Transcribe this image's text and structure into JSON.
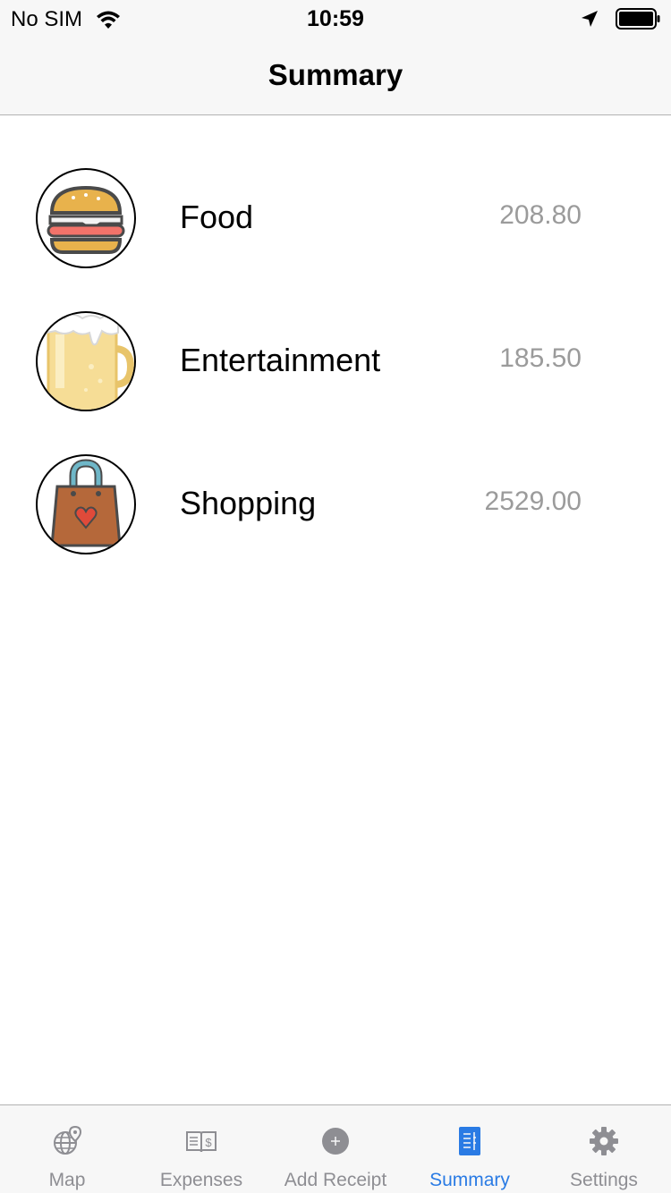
{
  "status_bar": {
    "carrier": "No SIM",
    "time": "10:59"
  },
  "nav": {
    "title": "Summary"
  },
  "categories": [
    {
      "icon": "burger-icon",
      "label": "Food",
      "amount": "208.80"
    },
    {
      "icon": "beer-mug-icon",
      "label": "Entertainment",
      "amount": "185.50"
    },
    {
      "icon": "shopping-bag-icon",
      "label": "Shopping",
      "amount": "2529.00"
    }
  ],
  "tab_bar": {
    "tabs": [
      {
        "icon": "globe-pin-icon",
        "label": "Map",
        "active": false
      },
      {
        "icon": "dollar-book-icon",
        "label": "Expenses",
        "active": false
      },
      {
        "icon": "plus-circle-icon",
        "label": "Add Receipt",
        "active": false
      },
      {
        "icon": "summary-list-icon",
        "label": "Summary",
        "active": true
      },
      {
        "icon": "gear-icon",
        "label": "Settings",
        "active": false
      }
    ]
  },
  "colors": {
    "accent": "#2a7be4",
    "inactive": "#8e8e93",
    "amount_text": "#9b9b9b",
    "bar_background": "#f7f7f7"
  }
}
